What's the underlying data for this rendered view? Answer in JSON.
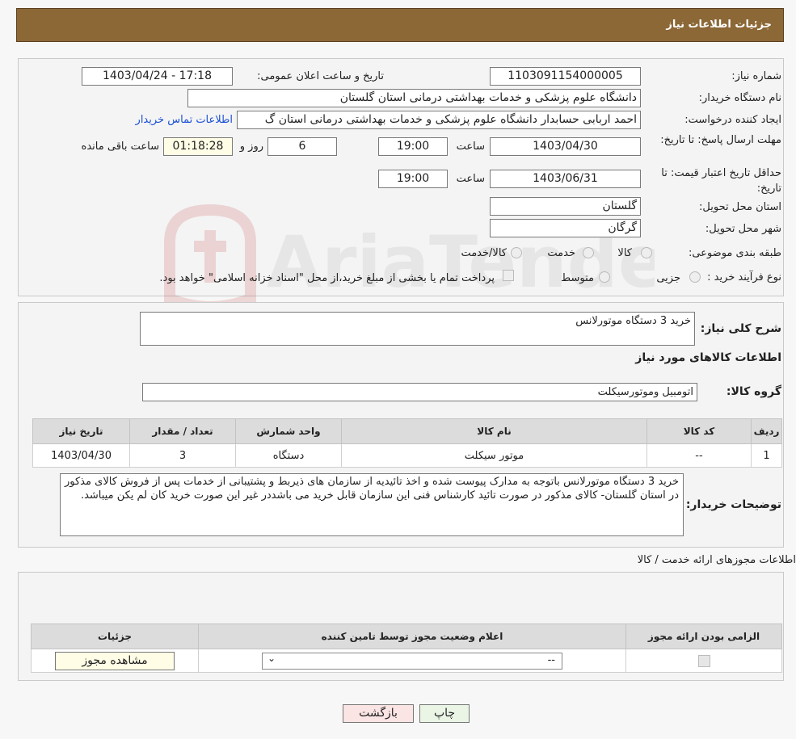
{
  "header": {
    "title": "جزئیات اطلاعات نیاز"
  },
  "form": {
    "need_number_label": "شماره نیاز:",
    "need_number": "1103091154000005",
    "announce_label": "تاریخ و ساعت اعلان عمومی:",
    "announce_value": "1403/04/24 - 17:18",
    "buyer_org_label": "نام دستگاه خریدار:",
    "buyer_org": "دانشگاه علوم پزشکی و خدمات بهداشتی درمانی استان گلستان",
    "requester_label": "ایجاد کننده درخواست:",
    "requester": "احمد اربابی حسابدار دانشگاه علوم پزشکی و خدمات بهداشتی درمانی استان گ",
    "contact_link": "اطلاعات تماس خریدار",
    "deadline_label": "مهلت ارسال پاسخ: تا تاریخ:",
    "deadline_date": "1403/04/30",
    "time_label": "ساعت",
    "deadline_time": "19:00",
    "days_value": "6",
    "days_label": "روز و",
    "remaining_time": "01:18:28",
    "remaining_label": "ساعت باقی مانده",
    "validity_label": "حداقل تاریخ اعتبار قیمت: تا تاریخ:",
    "validity_date": "1403/06/31",
    "validity_time": "19:00",
    "province_label": "استان محل تحویل:",
    "province": "گلستان",
    "city_label": "شهر محل تحویل:",
    "city": "گرگان",
    "category_label": "طبقه بندی موضوعی:",
    "category_options": [
      "کالا",
      "خدمت",
      "کالا/خدمت"
    ],
    "process_label": "نوع فرآیند خرید :",
    "process_options": [
      "جزیی",
      "متوسط"
    ],
    "payment_note": "پرداخت تمام یا بخشی از مبلغ خرید،از محل \"اسناد خزانه اسلامی\" خواهد بود."
  },
  "details": {
    "summary_label": "شرح کلی نیاز:",
    "summary": "خرید 3 دستگاه موتورلانس",
    "goods_title": "اطلاعات کالاهای مورد نیاز",
    "group_label": "گروه کالا:",
    "group": "اتومبیل وموتورسیکلت",
    "table": {
      "headers": [
        "ردیف",
        "کد کالا",
        "نام کالا",
        "واحد شمارش",
        "تعداد / مقدار",
        "تاریخ نیاز"
      ],
      "rows": [
        [
          "1",
          "--",
          "موتور سیکلت",
          "دستگاه",
          "3",
          "1403/04/30"
        ]
      ]
    },
    "buyer_notes_label": "توضیحات خریدار:",
    "buyer_notes": "خرید 3 دستگاه موتورلانس باتوجه به مدارک پیوست شده و اخذ تائیدیه از سازمان های ذیربط و پشتیبانی از خدمات پس از فروش کالای مذکور در استان گلستان- کالای مذکور در صورت تائید کارشناس فنی این سازمان قابل خرید می باشددر غیر این صورت خرید کان لم یکن میباشد."
  },
  "permits": {
    "title": "اطلاعات مجوزهای ارائه خدمت / کالا",
    "headers": [
      "الزامی بودن ارائه مجوز",
      "اعلام وضعیت مجوز توسط تامین کننده",
      "جزئیات"
    ],
    "select_value": "--",
    "view_button": "مشاهده مجوز"
  },
  "buttons": {
    "print": "چاپ",
    "back": "بازگشت"
  },
  "watermark": {
    "text": "AriaTender.neT"
  }
}
